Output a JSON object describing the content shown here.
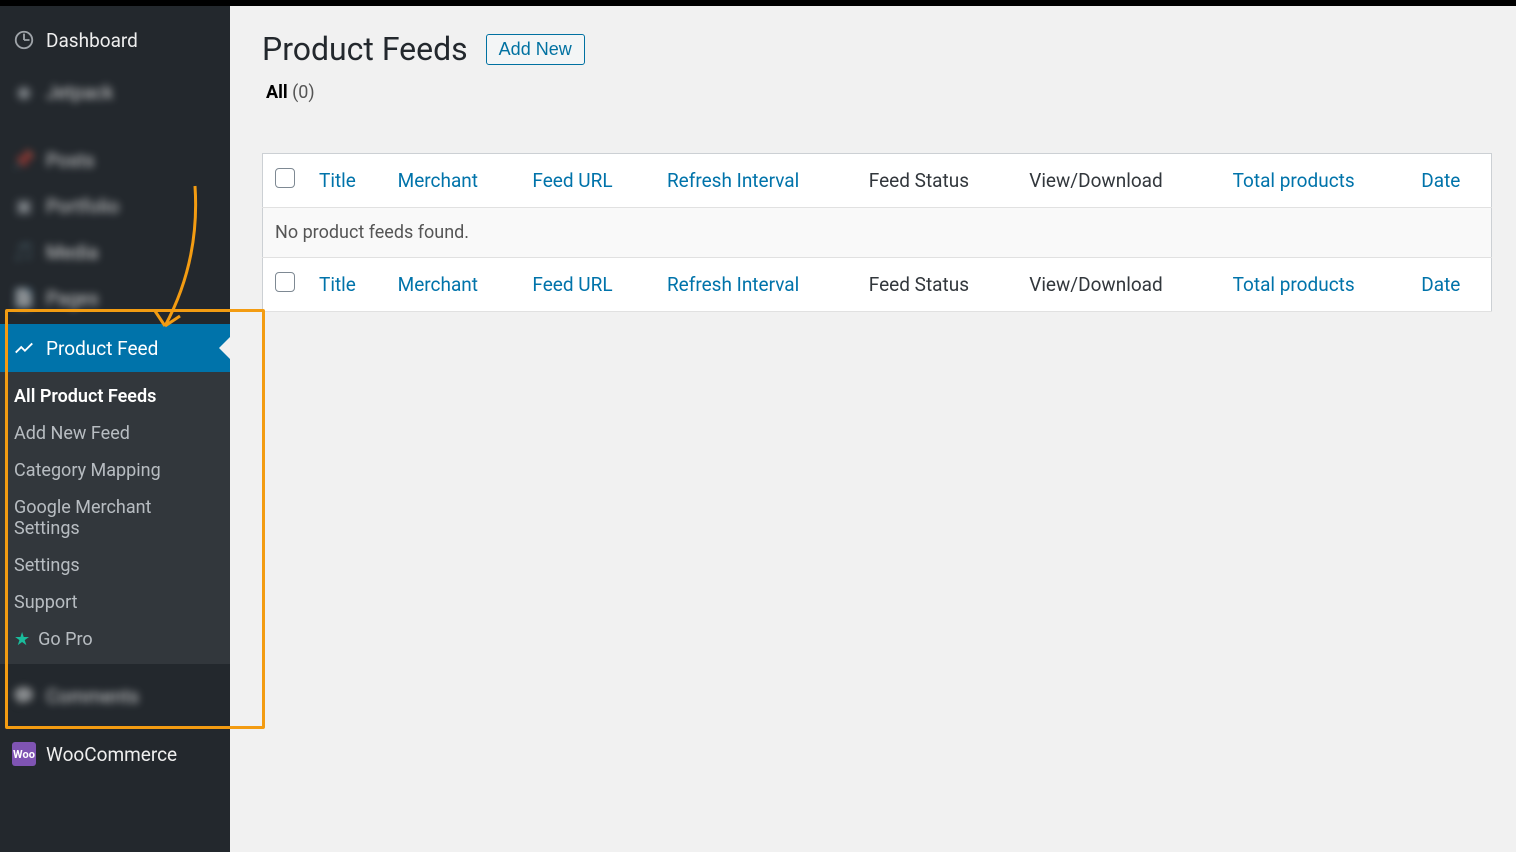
{
  "sidebar": {
    "dashboard": "Dashboard",
    "jetpack": "Jetpack",
    "posts": "Posts",
    "portfolio": "Portfolio",
    "media": "Media",
    "pages": "Pages",
    "product_feed": "Product Feed",
    "comments": "Comments",
    "woocommerce": "WooCommerce",
    "submenu": {
      "all": "All Product Feeds",
      "add_new": "Add New Feed",
      "category_mapping": "Category Mapping",
      "google_merchant": "Google Merchant Settings",
      "settings": "Settings",
      "support": "Support",
      "go_pro": "Go Pro"
    }
  },
  "page": {
    "title": "Product Feeds",
    "add_new": "Add New",
    "filter_all": "All",
    "filter_count": "(0)",
    "empty": "No product feeds found."
  },
  "columns": {
    "title": "Title",
    "merchant": "Merchant",
    "feed_url": "Feed URL",
    "refresh": "Refresh Interval",
    "status": "Feed Status",
    "view_download": "View/Download",
    "total_products": "Total products",
    "date": "Date"
  }
}
